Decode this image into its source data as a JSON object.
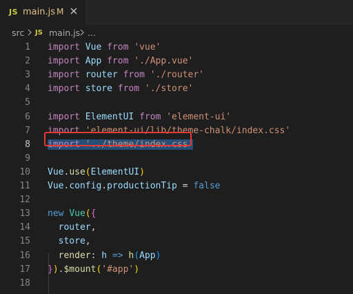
{
  "tab": {
    "lang_badge": "JS",
    "filename": "main.js",
    "status": "M",
    "close_icon": "close-icon"
  },
  "breadcrumb": {
    "folder": "src",
    "lang_badge": "JS",
    "file": "main.js",
    "ellipsis": "..."
  },
  "editor": {
    "active_line": 8,
    "lines": [
      {
        "n": "1",
        "tokens": [
          [
            "kw2",
            "import"
          ],
          [
            "",
            " "
          ],
          [
            "var",
            "Vue"
          ],
          [
            "",
            " "
          ],
          [
            "kw2",
            "from"
          ],
          [
            "",
            " "
          ],
          [
            "str",
            "'vue'"
          ]
        ]
      },
      {
        "n": "2",
        "tokens": [
          [
            "kw2",
            "import"
          ],
          [
            "",
            " "
          ],
          [
            "var",
            "App"
          ],
          [
            "",
            " "
          ],
          [
            "kw2",
            "from"
          ],
          [
            "",
            " "
          ],
          [
            "str",
            "'./App.vue'"
          ]
        ]
      },
      {
        "n": "3",
        "tokens": [
          [
            "kw2",
            "import"
          ],
          [
            "",
            " "
          ],
          [
            "var",
            "router"
          ],
          [
            "",
            " "
          ],
          [
            "kw2",
            "from"
          ],
          [
            "",
            " "
          ],
          [
            "str",
            "'./router'"
          ]
        ]
      },
      {
        "n": "4",
        "tokens": [
          [
            "kw2",
            "import"
          ],
          [
            "",
            " "
          ],
          [
            "var",
            "store"
          ],
          [
            "",
            " "
          ],
          [
            "kw2",
            "from"
          ],
          [
            "",
            " "
          ],
          [
            "str",
            "'./store'"
          ]
        ]
      },
      {
        "n": "5",
        "tokens": []
      },
      {
        "n": "6",
        "tokens": [
          [
            "kw2",
            "import"
          ],
          [
            "",
            " "
          ],
          [
            "var",
            "ElementUI"
          ],
          [
            "",
            " "
          ],
          [
            "kw2",
            "from"
          ],
          [
            "",
            " "
          ],
          [
            "str",
            "'element-ui'"
          ]
        ]
      },
      {
        "n": "7",
        "tokens": [
          [
            "kw2",
            "import"
          ],
          [
            "",
            " "
          ],
          [
            "str",
            "'element-ui/lib/theme-chalk/index.css'"
          ]
        ]
      },
      {
        "n": "8",
        "tokens": [
          [
            "kw2 sel",
            "import"
          ],
          [
            "sel",
            " "
          ],
          [
            "str sel",
            "'../theme/index.css'"
          ]
        ]
      },
      {
        "n": "9",
        "tokens": []
      },
      {
        "n": "10",
        "tokens": [
          [
            "var",
            "Vue"
          ],
          [
            "",
            "."
          ],
          [
            "fn",
            "use"
          ],
          [
            "br1",
            "("
          ],
          [
            "var",
            "ElementUI"
          ],
          [
            "br1",
            ")"
          ]
        ]
      },
      {
        "n": "11",
        "tokens": [
          [
            "var",
            "Vue"
          ],
          [
            "",
            "."
          ],
          [
            "var",
            "config"
          ],
          [
            "",
            "."
          ],
          [
            "var",
            "productionTip"
          ],
          [
            "",
            " = "
          ],
          [
            "bool",
            "false"
          ]
        ]
      },
      {
        "n": "12",
        "tokens": []
      },
      {
        "n": "13",
        "tokens": [
          [
            "kw",
            "new"
          ],
          [
            "",
            " "
          ],
          [
            "cls",
            "Vue"
          ],
          [
            "br1",
            "("
          ],
          [
            "br2",
            "{"
          ]
        ]
      },
      {
        "n": "14",
        "tokens": [
          [
            "",
            "  "
          ],
          [
            "var",
            "router"
          ],
          [
            "",
            ","
          ]
        ]
      },
      {
        "n": "15",
        "tokens": [
          [
            "",
            "  "
          ],
          [
            "var",
            "store"
          ],
          [
            "",
            ","
          ]
        ]
      },
      {
        "n": "16",
        "tokens": [
          [
            "",
            "  "
          ],
          [
            "fn",
            "render"
          ],
          [
            "",
            ": "
          ],
          [
            "var",
            "h"
          ],
          [
            "",
            " "
          ],
          [
            "kw",
            "=>"
          ],
          [
            "",
            " "
          ],
          [
            "fn",
            "h"
          ],
          [
            "br3",
            "("
          ],
          [
            "var",
            "App"
          ],
          [
            "br3",
            ")"
          ]
        ]
      },
      {
        "n": "17",
        "tokens": [
          [
            "br2",
            "}"
          ],
          [
            "br1",
            ")"
          ],
          [
            "",
            "."
          ],
          [
            "fn",
            "$mount"
          ],
          [
            "br1",
            "("
          ],
          [
            "str",
            "'#app'"
          ],
          [
            "br1",
            ")"
          ]
        ]
      },
      {
        "n": "18",
        "tokens": []
      }
    ]
  }
}
